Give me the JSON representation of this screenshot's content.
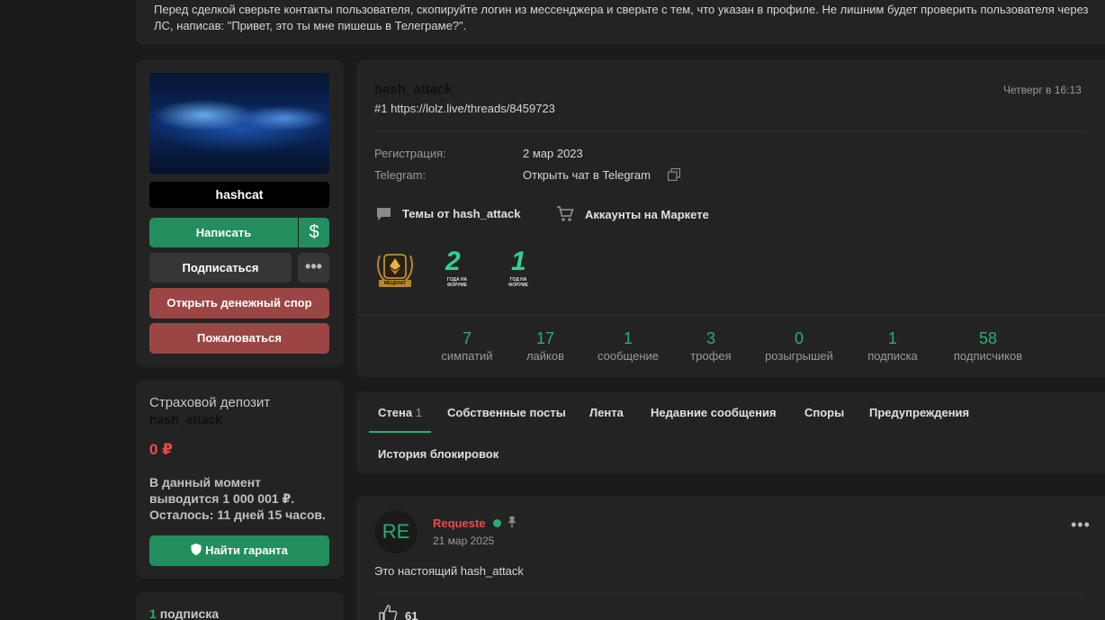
{
  "notice": {
    "text": "Перед сделкой сверьте контакты пользователя, скопируйте логин из мессенджера и сверьте с тем, что указан в профиле. Не лишним будет проверить пользователя через ЛС, написав: \"Привет, это ты мне пишешь в Телеграме?\"."
  },
  "profile": {
    "username": "hashcat",
    "write_label": "Написать",
    "money_icon": "$",
    "subscribe_label": "Подписаться",
    "more_icon": "•••",
    "dispute_label": "Открыть денежный спор",
    "report_label": "Пожаловаться"
  },
  "deposit": {
    "title": "Страховой депозит",
    "user": "hash_attack",
    "amount": "0 ₽",
    "note": "В данный момент выводится 1 000 001 ₽. Осталось: 11 дней 15 часов.",
    "guarantee_label": "Найти гаранта"
  },
  "subscriptions": {
    "count": "1",
    "label": "подписка"
  },
  "info": {
    "author": "hash_attack",
    "ref": "#1 https://lolz.live/threads/8459723",
    "time": "Четверг в 16:13",
    "reg_label": "Регистрация:",
    "reg_value": "2 мар 2023",
    "tg_label": "Telegram:",
    "tg_value": "Открыть чат в Telegram",
    "topics_link": "Темы от hash_attack",
    "market_link": "Аккаунты на Маркете",
    "trophies": {
      "patron": "МЕЦЕНАТ",
      "years2_num": "2",
      "years2_text": "ГОДА НА ФОРУМЕ",
      "years1_num": "1",
      "years1_text": "ГОД НА ФОРУМЕ"
    },
    "stats": [
      {
        "value": "7",
        "label": "симпатий"
      },
      {
        "value": "17",
        "label": "лайков"
      },
      {
        "value": "1",
        "label": "сообщение"
      },
      {
        "value": "3",
        "label": "трофея"
      },
      {
        "value": "0",
        "label": "розыгрышей"
      },
      {
        "value": "1",
        "label": "подписка"
      },
      {
        "value": "58",
        "label": "подписчиков"
      }
    ]
  },
  "tabs": {
    "wall": "Стена",
    "wall_count": "1",
    "own_posts": "Собственные посты",
    "feed": "Лента",
    "recent": "Недавние сообщения",
    "disputes": "Споры",
    "warnings": "Предупреждения",
    "bans": "История блокировок"
  },
  "post": {
    "avatar_text": "RE",
    "user": "Requeste",
    "date": "21 мар 2025",
    "menu_icon": "•••",
    "text": "Это настоящий hash_attack",
    "likes": "61"
  },
  "colors": {
    "accent": "#2bad72",
    "danger": "#9c4545",
    "red_text": "#f24949",
    "background": "#1b1b1b",
    "card": "#232323"
  }
}
